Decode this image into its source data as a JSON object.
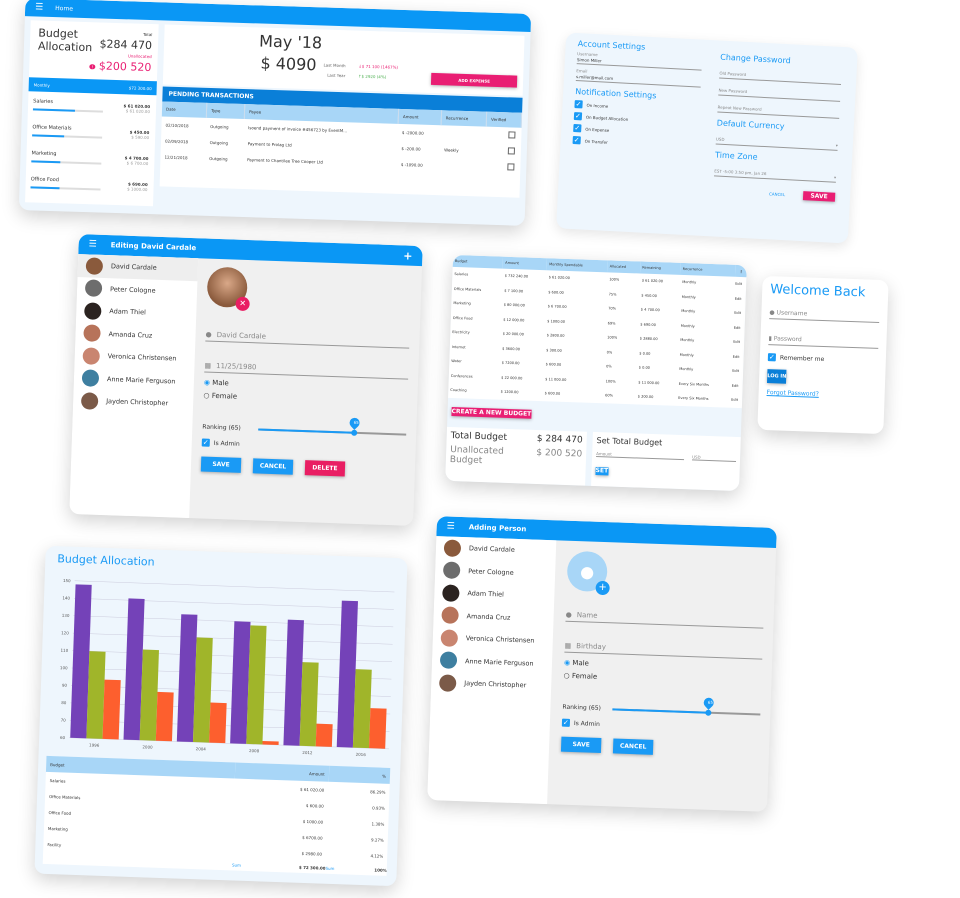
{
  "colors": {
    "primary": "#0a97f5",
    "accent": "#e91e73",
    "purple": "#7442b8",
    "green": "#a0b52a",
    "orange": "#fd5f2e"
  },
  "home": {
    "title": "Home",
    "menu_icon": "hamburger-icon",
    "budget_title": "Budget Allocation",
    "total_label": "Total",
    "total": "$284 470",
    "unallocated_label": "Unallocated",
    "unallocated": "$200 520",
    "unallocated_badge": "!",
    "monthly_label": "Monthly",
    "monthly": "$72 300.00",
    "lines": [
      {
        "name": "Salaries",
        "spent": "$ 61 020.00",
        "budget": "$ 61 020.00",
        "progress": 1.0
      },
      {
        "name": "Office Materials",
        "spent": "$ 450.00",
        "budget": "$ 590.00",
        "progress": 0.76
      },
      {
        "name": "Marketing",
        "spent": "$ 4 700.00",
        "budget": "$ 6 700.00",
        "progress": 0.7
      },
      {
        "name": "Office Food",
        "spent": "$ 690.00",
        "budget": "$ 1000.00",
        "progress": 0.69
      }
    ],
    "month": "May '18",
    "month_total": "$ 4090",
    "last_month_label": "Last Month",
    "last_month": "↓$ 71 100 (1467%)",
    "last_year_label": "Last Year",
    "last_year": "↑$ 2920 (4%)",
    "add_expense": "ADD EXPENSE",
    "pending_title": "PENDING TRANSACTIONS",
    "columns": [
      "Date",
      "Type",
      "Payee",
      "Amount",
      "Recurrence",
      "Verified"
    ],
    "rows": [
      {
        "date": "02/10/2018",
        "type": "Outgoing",
        "payee": "Isoend payment of invoice #456723 by EventM...",
        "amount": "$ -2000.00",
        "recurrence": ""
      },
      {
        "date": "02/09/2018",
        "type": "Outgoing",
        "payee": "Payment to Prolag Ltd",
        "amount": "$ -200.00",
        "recurrence": "Weekly"
      },
      {
        "date": "12/21/2018",
        "type": "Outgoing",
        "payee": "Payment to Chantilee Tree Cooper Ltd",
        "amount": "$ -1090.00",
        "recurrence": ""
      }
    ]
  },
  "settings": {
    "account_title": "Account Settings",
    "username_label": "Username",
    "username": "Simon Miller",
    "email_label": "Email",
    "email": "s.miller@mail.com",
    "notif_title": "Notification Settings",
    "notifs": [
      "On Income",
      "On Budget Allocation",
      "On Expense",
      "On Transfer"
    ],
    "password_title": "Change Password",
    "old_pw": "Old Password",
    "new_pw": "New Password",
    "repeat_pw": "Repeat New Password",
    "currency_title": "Default Currency",
    "currency": "USD",
    "tz_title": "Time Zone",
    "tz": "EST -5:00 3:50 pm, Jan 26",
    "cancel": "CANCEL",
    "save": "SAVE"
  },
  "people": [
    "David Cardale",
    "Peter Cologne",
    "Adam Thiel",
    "Amanda Cruz",
    "Veronica Christensen",
    "Anne Marie Ferguson",
    "Jayden Christopher"
  ],
  "avatar_colors": [
    "#8a5a3c",
    "#6d6d6d",
    "#2b2320",
    "#b7735a",
    "#c98570",
    "#3e7fa0",
    "#7b5a48"
  ],
  "edit": {
    "title": "Editing David Cardale",
    "name": "David Cardale",
    "birthday": "11/25/1980",
    "male": "Male",
    "female": "Female",
    "ranking_label": "Ranking (65)",
    "ranking": 65,
    "is_admin": "Is Admin",
    "save": "SAVE",
    "cancel": "CANCEL",
    "delete": "DELETE"
  },
  "add": {
    "title": "Adding Person",
    "name_placeholder": "Name",
    "birthday_placeholder": "Birthday",
    "male": "Male",
    "female": "Female",
    "ranking_label": "Ranking (65)",
    "ranking": 65,
    "is_admin": "Is Admin",
    "save": "SAVE",
    "cancel": "CANCEL"
  },
  "budgets": {
    "columns": [
      "Budget",
      "Amount",
      "Monthly Spendable",
      "Allocated",
      "Remaining",
      "Recurrence"
    ],
    "edit": "Edit",
    "rows": [
      [
        "Salaries",
        "$ 732 240.00",
        "$ 61 020.00",
        "100%",
        "$ 61 020.00",
        "Monthly"
      ],
      [
        "Office Materials",
        "$ 7 100.00",
        "$ 600.00",
        "75%",
        "$ 450.00",
        "Monthly"
      ],
      [
        "Marketing",
        "$ 80 000.00",
        "$ 6 700.00",
        "70%",
        "$ 4 700.00",
        "Monthly"
      ],
      [
        "Office Food",
        "$ 12 000.00",
        "$ 1000.00",
        "69%",
        "$ 690.00",
        "Monthly"
      ],
      [
        "Electricity",
        "$ 20 000.00",
        "$ 2800.00",
        "100%",
        "$ 2880.00",
        "Monthly"
      ],
      [
        "Internet",
        "$ 3600.00",
        "$ 300.00",
        "0%",
        "$ 0.00",
        "Monthly"
      ],
      [
        "Water",
        "$ 7200.00",
        "$ 600.00",
        "0%",
        "$ 0.00",
        "Monthly"
      ],
      [
        "Conferences",
        "$ 22 000.00",
        "$ 11 000.00",
        "100%",
        "$ 11 000.00",
        "Every Six Months"
      ],
      [
        "Coaching",
        "$ 1200.00",
        "$ 600.00",
        "60%",
        "$ 200.00",
        "Every Six Months"
      ]
    ],
    "create": "CREATE A NEW BUDGET",
    "total_label": "Total Budget",
    "total": "$ 284 470",
    "unalloc_label": "Unallocated Budget",
    "unalloc": "$ 200 520",
    "set_title": "Set Total Budget",
    "amount_placeholder": "Amount",
    "currency": "USD",
    "set": "SET"
  },
  "login": {
    "title": "Welcome Back",
    "username": "Username",
    "password": "Password",
    "remember": "Remember me",
    "login": "LOG IN",
    "forgot": "Forgot Password?"
  },
  "chart_card": {
    "title": "Budget Allocation",
    "table_columns": [
      "Budget",
      "Amount",
      "%"
    ],
    "table_rows": [
      [
        "Salaries",
        "$ 61 020.00",
        "86.29%"
      ],
      [
        "Office Materials",
        "$ 600.00",
        "0.93%"
      ],
      [
        "Office Food",
        "$ 1000.00",
        "1.38%"
      ],
      [
        "Marketing",
        "$ 6700.00",
        "9.27%"
      ],
      [
        "Facility",
        "$ 2980.00",
        "4.12%"
      ]
    ],
    "sum_label": "Sum",
    "sum_amount": "$ 72 300.00",
    "sum_pct": "100%"
  },
  "chart_data": {
    "type": "bar",
    "categories": [
      "1996",
      "2000",
      "2004",
      "2008",
      "2012",
      "2016"
    ],
    "series": [
      {
        "values": [
          148,
          141,
          133,
          130,
          132,
          144
        ],
        "color": "#7442b8"
      },
      {
        "values": [
          110,
          112,
          120,
          128,
          108,
          105
        ],
        "color": "#a0b52a"
      },
      {
        "values": [
          94,
          88,
          83,
          62,
          73,
          83
        ],
        "color": "#fd5f2e"
      }
    ],
    "ylim": [
      60,
      150
    ],
    "yticks": [
      "60",
      "70",
      "80",
      "90",
      "100",
      "110",
      "120",
      "130",
      "140",
      "150"
    ],
    "grid": true
  }
}
